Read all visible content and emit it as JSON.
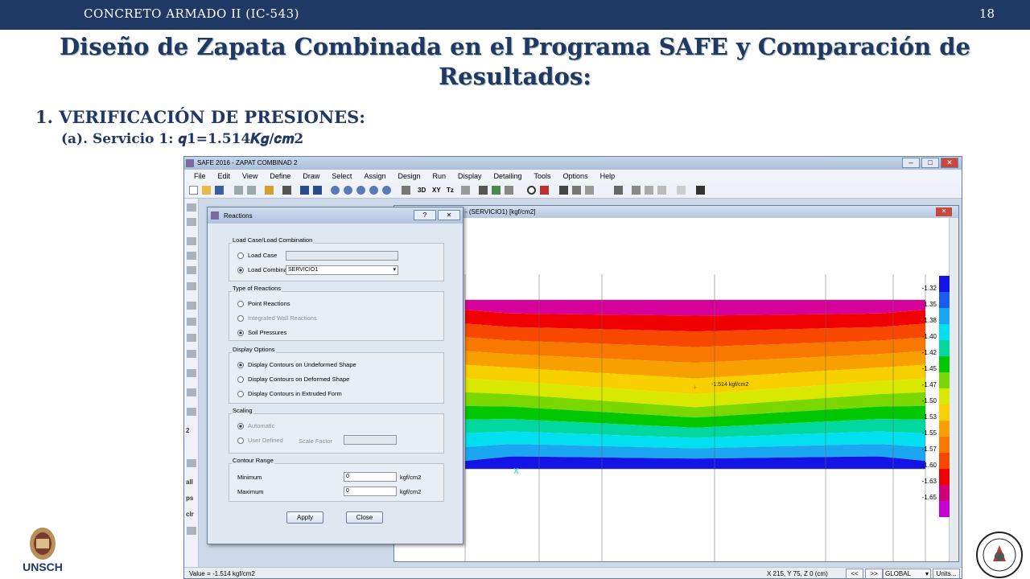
{
  "header": {
    "course": "CONCRETO ARMADO II (IC-543)",
    "page": "18"
  },
  "title": "Diseño de Zapata Combinada en el Programa SAFE y Comparación de Resultados:",
  "section": "1. VERIFICACIÓN DE PRESIONES:",
  "subsection": "(a). Servicio 1: 𝒒𝟏=𝟏.𝟓14𝑲𝒈/𝒄𝒎𝟐",
  "logo_left_text": "UNSCH",
  "app": {
    "window_title": "SAFE 2016 - ZAPAT COMBINAD 2",
    "menu": [
      "File",
      "Edit",
      "View",
      "Define",
      "Draw",
      "Select",
      "Assign",
      "Design",
      "Run",
      "Display",
      "Detailing",
      "Tools",
      "Options",
      "Help"
    ],
    "toolbar_text": [
      "3D",
      "XY",
      "Tz"
    ],
    "left_tool_text": [
      "2",
      "all",
      "ps",
      "clr"
    ],
    "plot_title": "ram - (SERVICIO1)  [kgf/cm2]",
    "annotation": "-1.514 kgf/cm2",
    "axis_labels": {
      "x": "X",
      "y": "Y"
    },
    "legend": {
      "colors": [
        "#1414e6",
        "#1a5cf0",
        "#1aa6f0",
        "#00e0f0",
        "#00d8a0",
        "#00c800",
        "#7ad800",
        "#d8e800",
        "#f8d000",
        "#f8a000",
        "#f87800",
        "#f84800",
        "#f00000",
        "#d0007a",
        "#c800d8"
      ],
      "ticks": [
        "-1.32",
        "-1.35",
        "-1.38",
        "-1.40",
        "-1.42",
        "-1.45",
        "-1.47",
        "-1.50",
        "-1.53",
        "-1.55",
        "-1.57",
        "-1.60",
        "-1.63",
        "-1.65"
      ]
    },
    "status": {
      "value": "Value = -1.514 kgf/cm2",
      "coords": "X 215,  Y 75,  Z 0   (cm)",
      "prev": "<<",
      "next": ">>",
      "system": "GLOBAL",
      "units": "Units..."
    },
    "dialog": {
      "title": "Reactions",
      "groups": {
        "load": {
          "label": "Load Case/Load Combination",
          "case": "Load Case",
          "combo": "Load Combination",
          "combo_value": "SERVICIO1"
        },
        "type": {
          "label": "Type of Reactions",
          "point": "Point Reactions",
          "wall": "Integrated Wall Reactions",
          "soil": "Soil Pressures"
        },
        "display": {
          "label": "Display Options",
          "opt1": "Display Contours on Undeformed Shape",
          "opt2": "Display Contours on Deformed Shape",
          "opt3": "Display Contours in Extruded Form"
        },
        "scaling": {
          "label": "Scaling",
          "auto": "Automatic",
          "user": "User Defined",
          "factor": "Scale Factor"
        },
        "range": {
          "label": "Contour Range",
          "min": "Minimum",
          "max": "Maximum",
          "min_val": "0",
          "max_val": "0",
          "unit": "kgf/cm2"
        }
      },
      "apply": "Apply",
      "close": "Close"
    }
  }
}
